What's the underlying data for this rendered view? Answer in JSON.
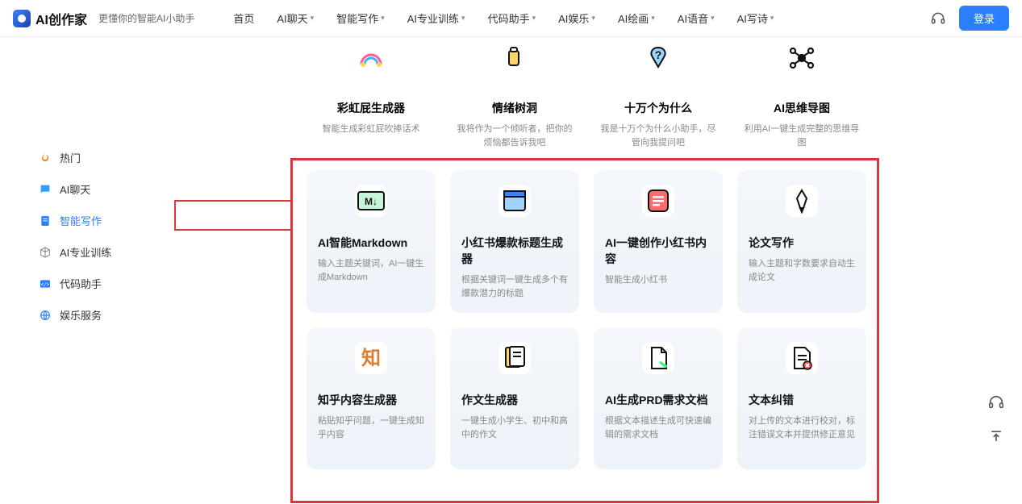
{
  "header": {
    "brand": "AI创作家",
    "subtitle": "更懂你的智能AI小助手",
    "login": "登录",
    "nav": [
      "首页",
      "AI聊天",
      "智能写作",
      "AI专业训练",
      "代码助手",
      "AI娱乐",
      "AI绘画",
      "AI语音",
      "AI写诗"
    ]
  },
  "sidebar": {
    "items": [
      {
        "label": "热门",
        "icon": "fire",
        "color": "#ff7a00"
      },
      {
        "label": "AI聊天",
        "icon": "chat",
        "color": "#2aa0ff"
      },
      {
        "label": "智能写作",
        "icon": "doc",
        "color": "#2a7fff",
        "active": true
      },
      {
        "label": "AI专业训练",
        "icon": "cube",
        "color": "#888"
      },
      {
        "label": "代码助手",
        "icon": "code",
        "color": "#2a7fff"
      },
      {
        "label": "娱乐服务",
        "icon": "globe",
        "color": "#2a7fff"
      }
    ]
  },
  "topRow": [
    {
      "title": "彩虹屁生成器",
      "desc": "智能生成彩虹屁吹捧话术",
      "icon": "rainbow"
    },
    {
      "title": "情绪树洞",
      "desc": "我将作为一个倾听者，把你的烦恼都告诉我吧",
      "icon": "cup"
    },
    {
      "title": "十万个为什么",
      "desc": "我是十万个为什么小助手，尽管向我提问吧",
      "icon": "question"
    },
    {
      "title": "AI思维导图",
      "desc": "利用AI一键生成完整的思维导图",
      "icon": "mindmap"
    }
  ],
  "cards": [
    {
      "title": "AI智能Markdown",
      "desc": "输入主题关键词，AI一键生成Markdown",
      "icon": "md"
    },
    {
      "title": "小红书爆款标题生成器",
      "desc": "根据关键词一键生成多个有爆款潜力的标题",
      "icon": "window"
    },
    {
      "title": "AI一键创作小红书内容",
      "desc": "智能生成小红书",
      "icon": "note"
    },
    {
      "title": "论文写作",
      "desc": "输入主题和字数要求自动生成论文",
      "icon": "pen"
    },
    {
      "title": "知乎内容生成器",
      "desc": "粘贴知乎问题，一键生成知乎内容",
      "icon": "zhi"
    },
    {
      "title": "作文生成器",
      "desc": "一键生成小学生、初中和高中的作文",
      "icon": "essay"
    },
    {
      "title": "AI生成PRD需求文档",
      "desc": "根据文本描述生成可快速编辑的需求文档",
      "icon": "prd"
    },
    {
      "title": "文本纠错",
      "desc": "对上传的文本进行校对，标注错误文本并提供修正意见",
      "icon": "correct"
    }
  ]
}
